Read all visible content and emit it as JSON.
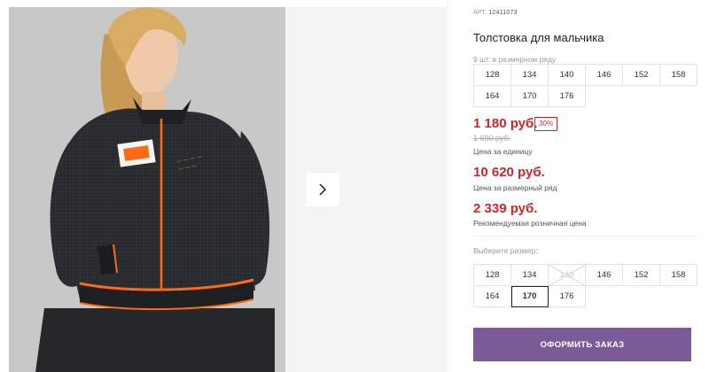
{
  "gallery": {
    "next_icon": "chevron-right-icon"
  },
  "product": {
    "article_label": "АРТ.",
    "article": "12411073",
    "title": "Толстовка для мальчика",
    "pack_label": "9 шт. в размерном ряду",
    "pack_sizes": [
      "128",
      "134",
      "140",
      "146",
      "152",
      "158",
      "164",
      "170",
      "176"
    ],
    "price": "1 180 руб.",
    "discount": "30%",
    "old_price": "1 690 руб.",
    "price_note": "Цена за единицу",
    "pack_price": "10 620 руб.",
    "pack_price_note": "Цена за размерный ряд",
    "rrp": "2 339 руб.",
    "rrp_note": "Рекомендуемая розничная цена",
    "select_label": "Выберите размер:",
    "select_sizes": [
      {
        "label": "128",
        "state": "available"
      },
      {
        "label": "134",
        "state": "available"
      },
      {
        "label": "140",
        "state": "disabled"
      },
      {
        "label": "146",
        "state": "available"
      },
      {
        "label": "152",
        "state": "available"
      },
      {
        "label": "158",
        "state": "available"
      },
      {
        "label": "164",
        "state": "available"
      },
      {
        "label": "170",
        "state": "selected"
      },
      {
        "label": "176",
        "state": "available"
      }
    ],
    "order_button": "ОФОРМИТЬ ЗАКАЗ"
  },
  "colors": {
    "price": "#d0252a",
    "button": "#7c5b97",
    "jacket": "#2a2b2f",
    "accent_orange": "#ff6a13"
  }
}
